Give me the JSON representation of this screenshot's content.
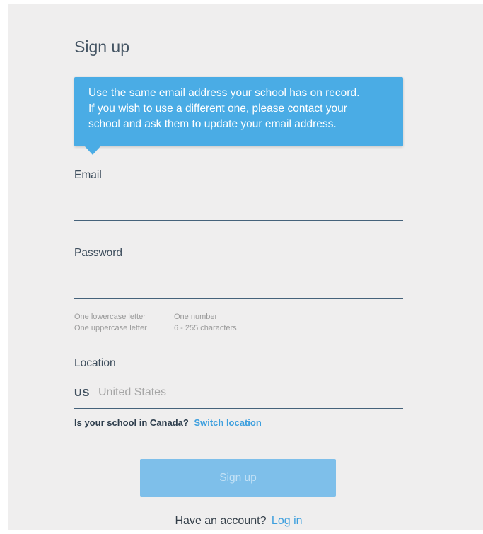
{
  "page": {
    "title": "Sign up"
  },
  "tooltip": {
    "lines": [
      "Use the same email address your school has on record.",
      "If you wish to use a different one, please contact your",
      "school and ask them to update your email address."
    ]
  },
  "email": {
    "label": "Email",
    "value": "",
    "placeholder": ""
  },
  "password": {
    "label": "Password",
    "value": "",
    "placeholder": "",
    "requirements": [
      [
        "One lowercase letter",
        "One number"
      ],
      [
        "One uppercase letter",
        "6 - 255 characters"
      ]
    ]
  },
  "location": {
    "label": "Location",
    "country_code": "US",
    "country_name": "United States",
    "canada_question": "Is your school in Canada?",
    "switch_label": "Switch location"
  },
  "actions": {
    "signup_label": "Sign up",
    "account_question": "Have an account?",
    "login_label": "Log in"
  },
  "colors": {
    "accent": "#4aace5",
    "link": "#3d9fde",
    "button_disabled": "#7ebfea",
    "background": "#efeeee"
  }
}
